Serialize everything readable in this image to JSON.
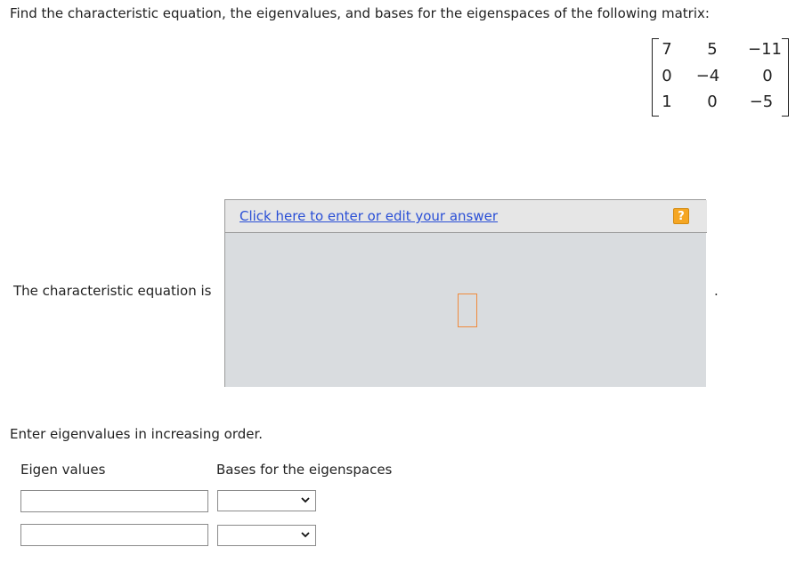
{
  "question": {
    "text": "Find the characteristic equation, the eigenvalues, and bases for the eigenspaces of the following matrix:"
  },
  "matrix": {
    "rows": [
      [
        "7",
        "5",
        "−11"
      ],
      [
        "0",
        "−4",
        "0"
      ],
      [
        "1",
        "0",
        "−5"
      ]
    ]
  },
  "answer_panel": {
    "link_text": "Click here to enter or edit your answer",
    "help_symbol": "?",
    "help_icon": "question-help-icon",
    "accent_color": "#f5a623",
    "placeholder_color": "#f08a3c"
  },
  "char_eq": {
    "label": "The characteristic equation is",
    "trailing_period": "."
  },
  "eigen_section": {
    "instruction": "Enter eigenvalues in increasing order.",
    "eigen_header": "Eigen values",
    "bases_header": "Bases for the eigenspaces",
    "rows": [
      {
        "value": "",
        "basis_selected": ""
      },
      {
        "value": "",
        "basis_selected": ""
      }
    ]
  }
}
